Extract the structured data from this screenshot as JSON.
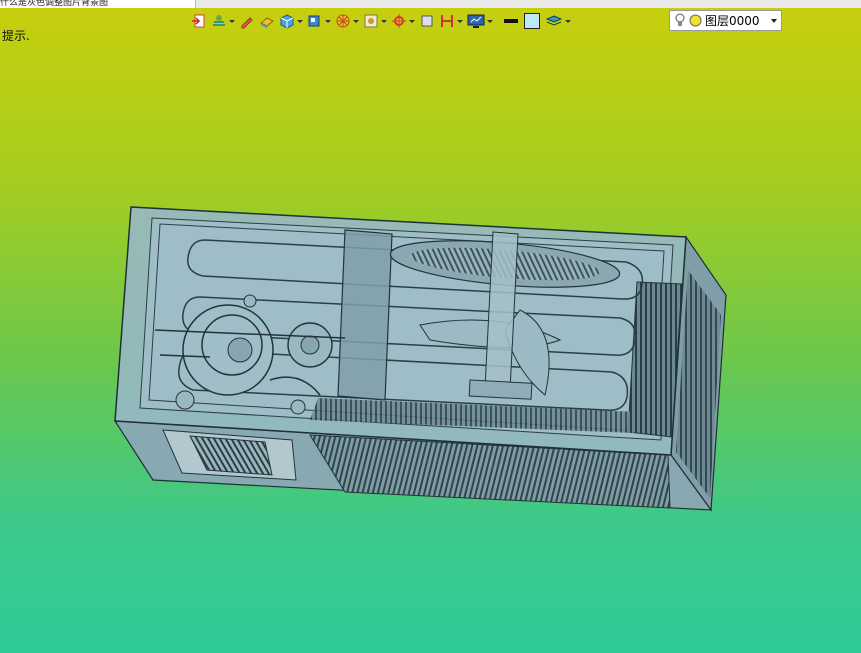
{
  "window": {
    "doc_tab_label": "什么是灰色调整图片背景图",
    "prompt_label": "提示."
  },
  "toolbar": {
    "tools": [
      {
        "name": "import-icon",
        "dropdown": false
      },
      {
        "name": "display-settings-icon",
        "dropdown": true
      },
      {
        "name": "pencil-icon",
        "dropdown": false
      },
      {
        "name": "eraser-icon",
        "dropdown": false
      },
      {
        "name": "cube-icon",
        "dropdown": true
      },
      {
        "name": "view-cube-icon",
        "dropdown": true
      },
      {
        "name": "wheel-icon",
        "dropdown": true
      },
      {
        "name": "frame-icon",
        "dropdown": true
      },
      {
        "name": "crosshair-icon",
        "dropdown": true
      },
      {
        "name": "square-icon",
        "dropdown": false
      },
      {
        "name": "dimension-icon",
        "dropdown": true
      },
      {
        "name": "monitor-icon",
        "dropdown": true
      },
      {
        "name": "line-weight-icon",
        "dropdown": false
      },
      {
        "name": "color-swatch-icon",
        "dropdown": false
      },
      {
        "name": "layers-icon",
        "dropdown": true
      }
    ],
    "layer": {
      "selected": "图层0000",
      "light_icon": "lightbulb-icon",
      "color_icon": "yellow-circle-icon"
    }
  },
  "colors": {
    "bg_top": "#c8cf0c",
    "bg_bottom": "#2ecb98",
    "housing": "#8fb4c0",
    "edge": "#23373f"
  }
}
